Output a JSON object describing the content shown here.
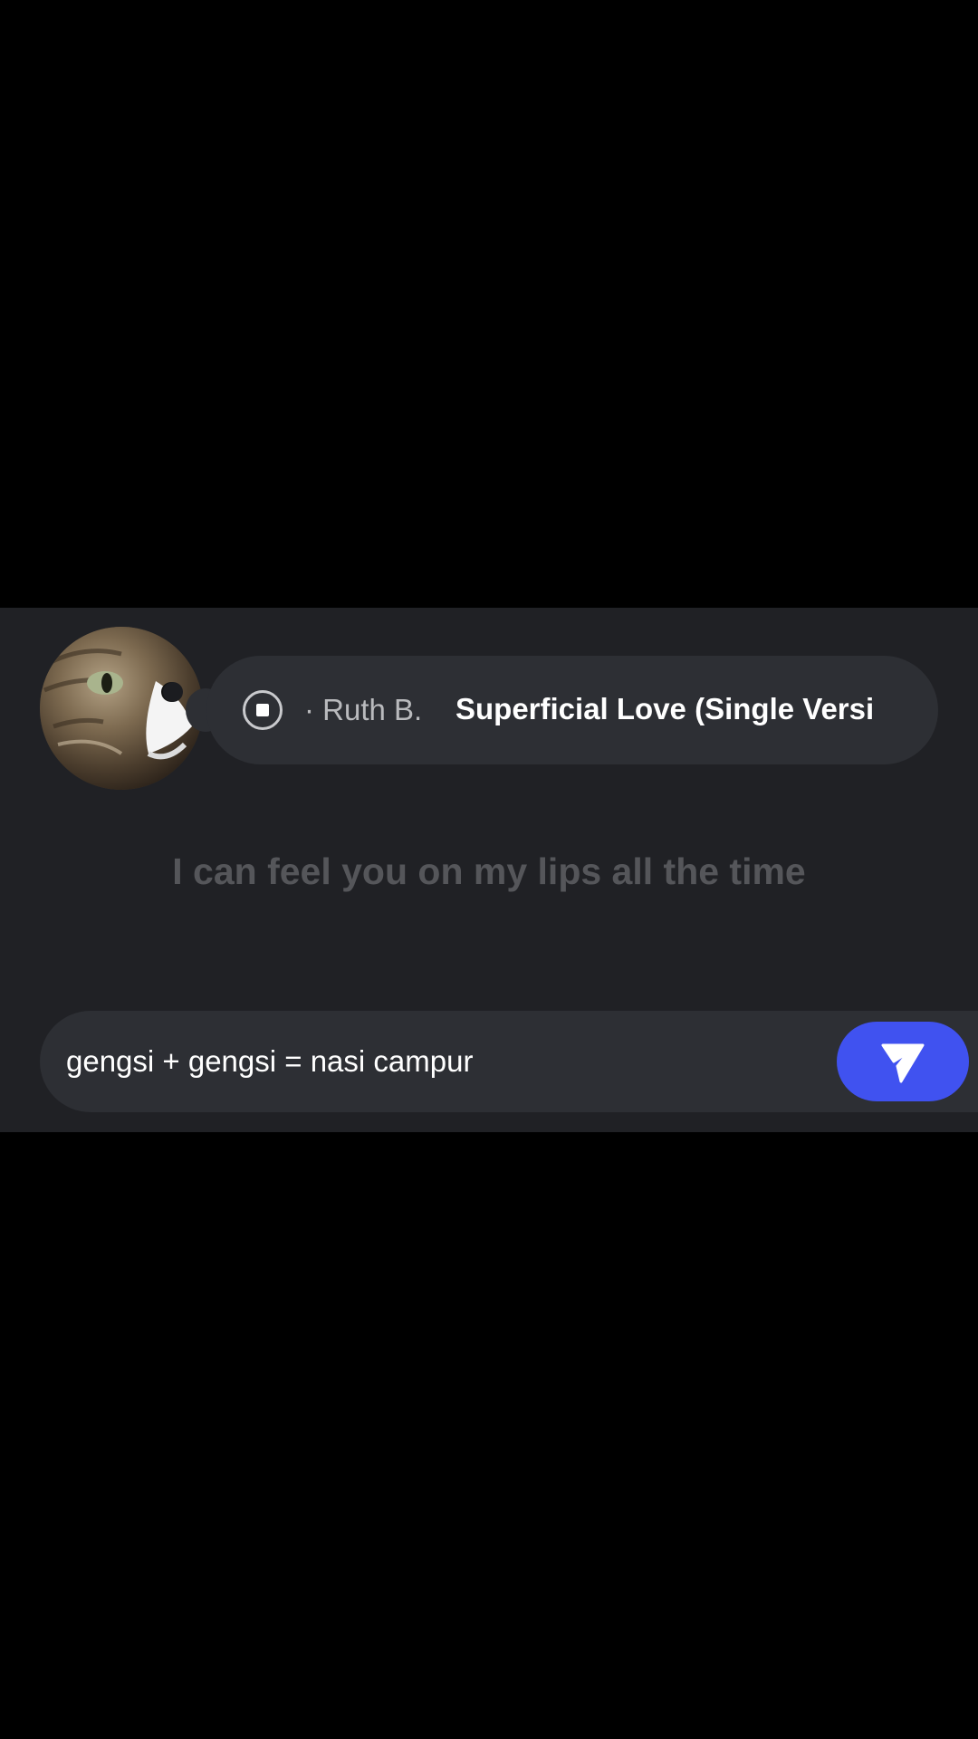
{
  "now_playing": {
    "artist": "· Ruth B.",
    "title": "Superficial Love (Single Versi"
  },
  "lyric": {
    "current_line": "I can feel you on my lips all the time"
  },
  "composer": {
    "text": "gengsi + gengsi = nasi campur"
  },
  "icons": {
    "stop": "stop-circle-icon",
    "send": "send-icon"
  },
  "colors": {
    "background": "#000000",
    "panel": "#202125",
    "pill": "#2d2f34",
    "accent": "#4052f0",
    "lyric_text": "#55565a"
  }
}
